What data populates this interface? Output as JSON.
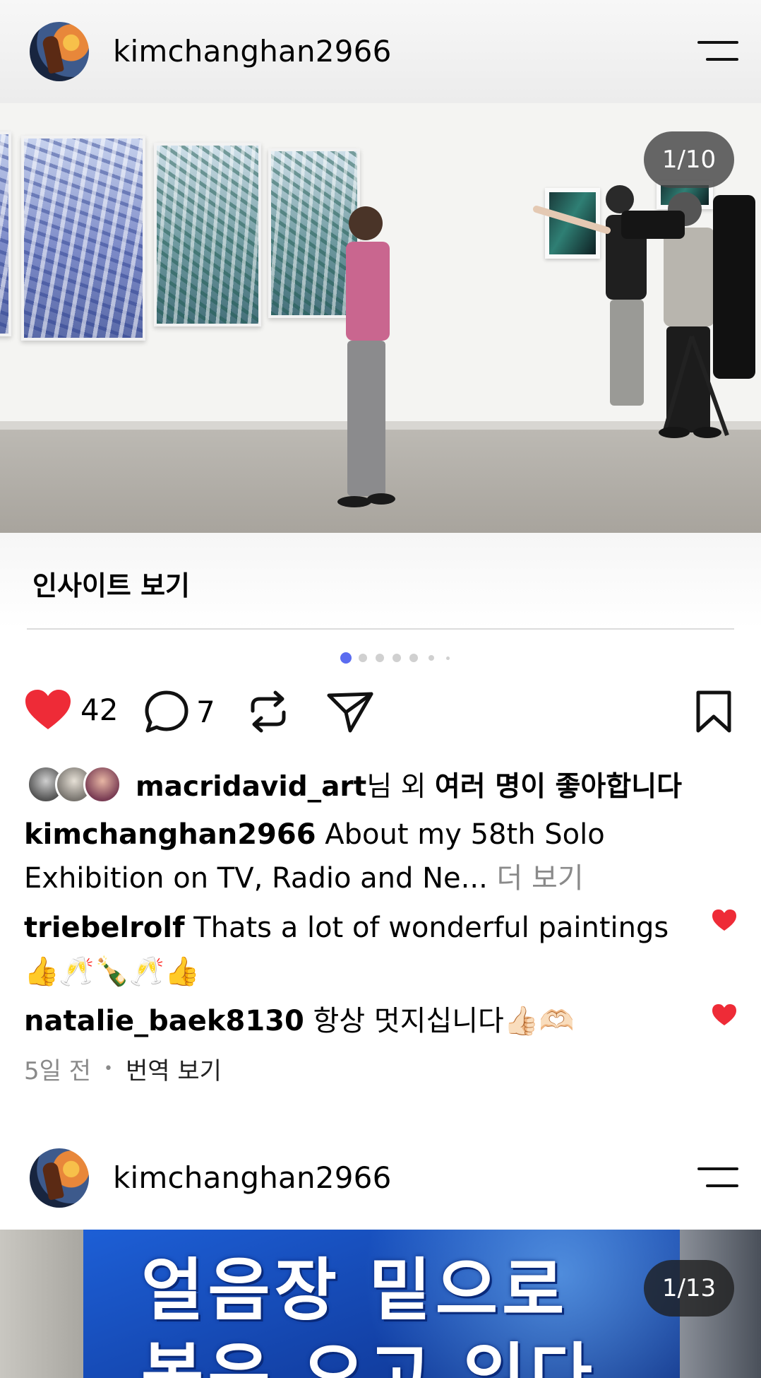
{
  "post1": {
    "username": "kimchanghan2966",
    "image_counter": "1/10",
    "insights_label": "인사이트 보기",
    "likes": "42",
    "comments_count": "7",
    "liked_by_user": "macridavid_art",
    "liked_by_suffix_1": "님 외 ",
    "liked_by_suffix_2": "여러 명이 좋아합니다",
    "caption_user": "kimchanghan2966",
    "caption_text": "About my 58th Solo Exhibition on TV, Radio and Ne...",
    "caption_more": "더 보기",
    "comments": [
      {
        "user": "triebelrolf",
        "text": "Thats a lot of wonderful paintings 👍🥂🍾🥂👍"
      },
      {
        "user": "natalie_baek8130",
        "text": "항상 멋지십니다👍🏻🫶🏻"
      }
    ],
    "time_ago": "5일 전",
    "translate_label": "번역 보기"
  },
  "post2": {
    "username": "kimchanghan2966",
    "image_counter": "1/13",
    "headline_line1": "얼음장 밑으로",
    "headline_line2": "봄은 오고 있다"
  },
  "colors": {
    "like_red": "#ee2b37",
    "dot_active": "#5b6cf0",
    "dot_inactive": "#d0d0d0",
    "secondary_text": "#8a8a8a"
  },
  "icons": [
    "menu-icon",
    "heart-icon",
    "comment-icon",
    "repost-icon",
    "share-icon",
    "bookmark-icon"
  ]
}
